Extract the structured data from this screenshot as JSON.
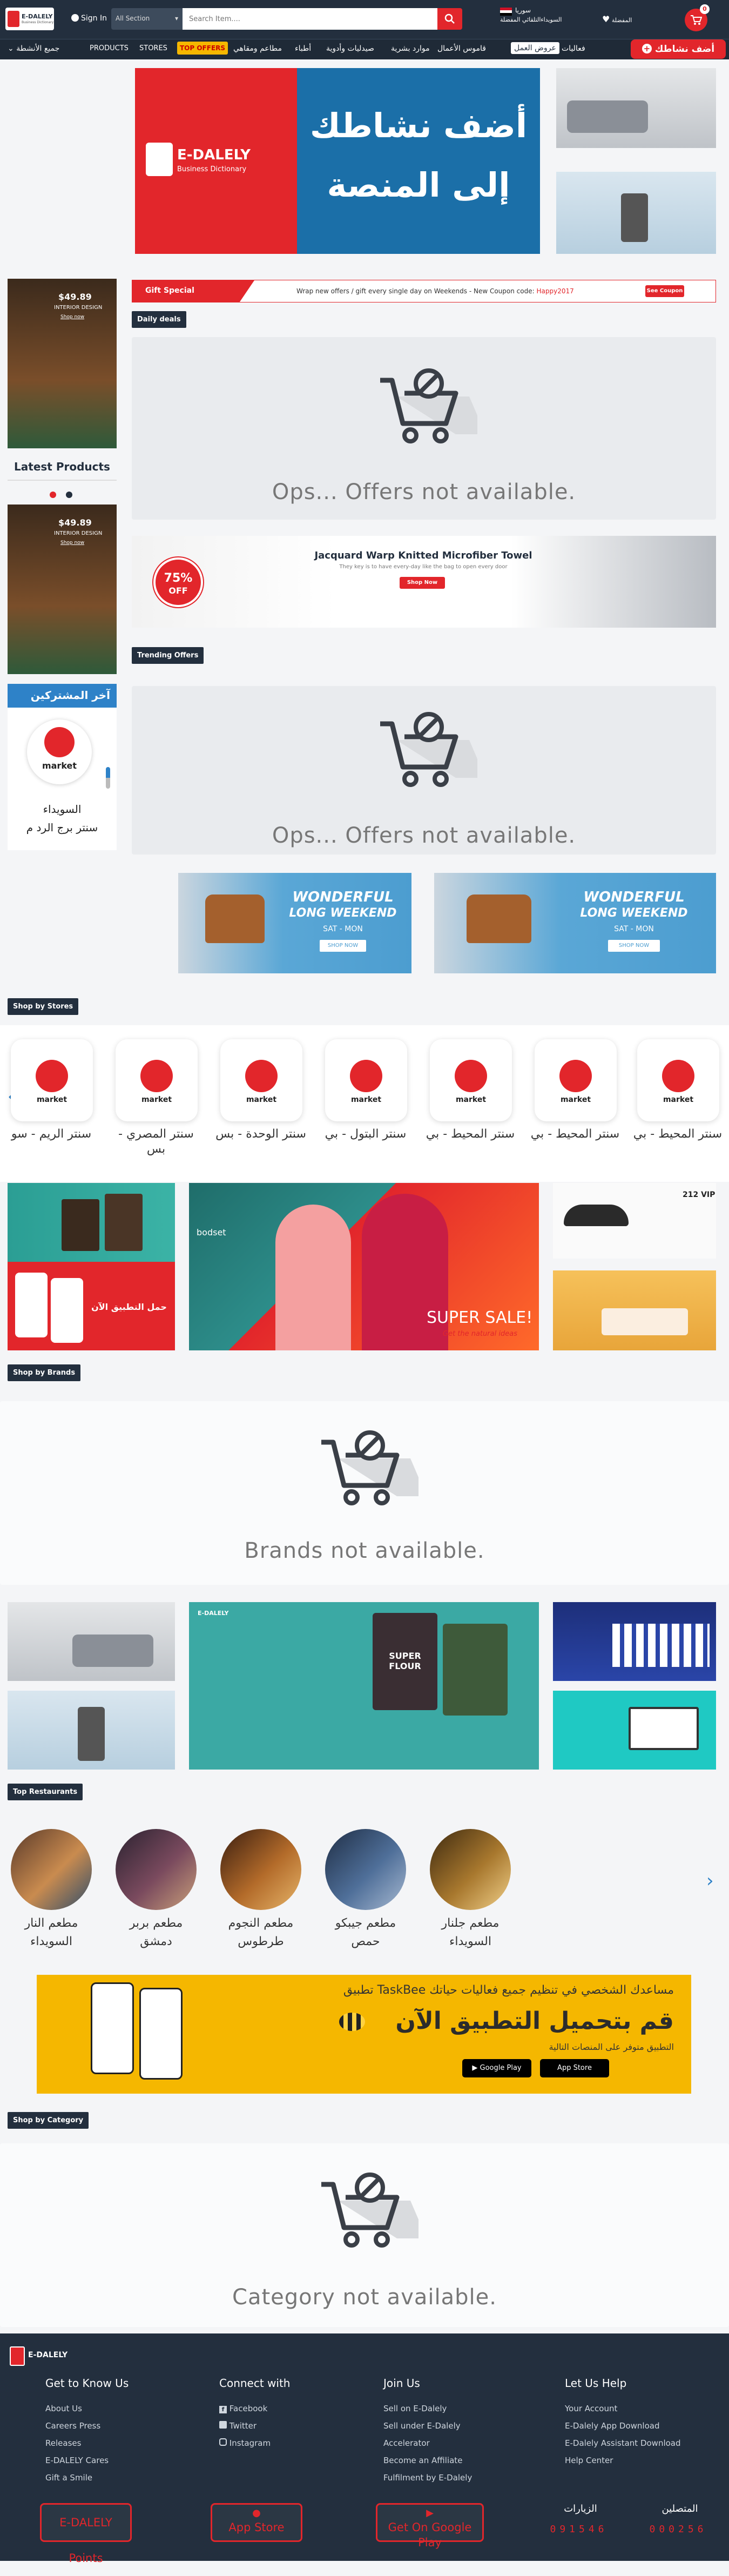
{
  "header": {
    "logo_text": "E-DALELY",
    "logo_sub": "Business Dictionary",
    "sign_in": "Sign In",
    "section_select": "All Section",
    "search_placeholder": "Search Item....",
    "country": "سوريا",
    "country_sub": "السويداءالتلقائي المفضلة",
    "favorites": "المفضلة",
    "cart_count": "0",
    "add_business": "أضف نشاطك"
  },
  "nav": {
    "all_activities": "جميع الأنشطة",
    "items": [
      "PRODUCTS",
      "STORES",
      "TOP OFFERS",
      "مطاعم ومقاهي",
      "أطباء",
      "صيدليات وأدوية",
      "موارد بشرية",
      "قاموس الأعمال",
      "عروض العمل",
      "فعاليات"
    ]
  },
  "hero": {
    "logo_text": "E-DALELY",
    "logo_sub": "Business Dictionary",
    "line1": "أضف نشاطك",
    "line2": "إلى المنصة"
  },
  "sidebar": {
    "promo_price": "$49.89",
    "promo_title": "INTERIOR DESIGN",
    "promo_link": "Shop now",
    "latest_products": "Latest Products",
    "latest_price": "$49.89",
    "latest_title": "INTERIOR DESIGN",
    "latest_link": "Shop now",
    "subscribers_title": "آخر المشتركين",
    "subscriber_logo": "market",
    "subscriber_city": "السويداء",
    "subscriber_name": "سنتر برج الرد م"
  },
  "gift": {
    "label": "Gift Special",
    "text": "Wrap new offers / gift every single day on Weekends - New Coupon code:",
    "code": "Happy2017",
    "button": "See Coupon"
  },
  "daily_deals": {
    "tag": "Daily deals",
    "empty": "Ops... Offers not available."
  },
  "towel_banner": {
    "badge_pct": "75%",
    "badge_off": "OFF",
    "title": "Jacquard Warp Knitted Microfiber Towel",
    "sub": "They key is to have every-day like the bag to open every door",
    "button": "Shop Now"
  },
  "trending": {
    "tag": "Trending Offers",
    "empty": "Ops... Offers not available."
  },
  "weekend_banners": [
    {
      "line1": "WONDERFUL",
      "line2": "LONG WEEKEND",
      "days": "SAT - MON",
      "button": "SHOP NOW"
    },
    {
      "line1": "WONDERFUL",
      "line2": "LONG WEEKEND",
      "days": "SAT - MON",
      "button": "SHOP NOW"
    }
  ],
  "stores": {
    "tag": "Shop by Stores",
    "logo": "market",
    "items": [
      "سنتر الريم - سو",
      "سنتر المصري - بس",
      "سنتر الوحدة - بس",
      "سنتر البتول - بي",
      "سنتر المحيط - بي",
      "سنتر المحيط - بي",
      "سنتر المحيط - بي"
    ]
  },
  "ads_row1": {
    "app_text": "حمل التطبيق الآن",
    "sale_brand": "bodset",
    "sale_text": "SUPER SALE!",
    "sale_sub": "Get the natural ideas",
    "beauty_brand": "212 VIP"
  },
  "brands": {
    "tag": "Shop by Brands",
    "empty": "Brands not available."
  },
  "ads_row2": {
    "flour_label": "SUPER FLOUR",
    "flour_logo": "E-DALELY"
  },
  "restaurants": {
    "tag": "Top Restaurants",
    "items": [
      {
        "name": "مطعم النار",
        "city": "السويداء"
      },
      {
        "name": "مطعم بربر",
        "city": "دمشق"
      },
      {
        "name": "مطعم النجوم",
        "city": "طرطوس"
      },
      {
        "name": "مطعم جيبكو",
        "city": "حمص"
      },
      {
        "name": "مطعم جلنار",
        "city": "السويداء"
      }
    ]
  },
  "taskbee": {
    "title": "تطبيق TaskBee مساعدك الشخصي في تنظيم جميع فعاليات حياتك",
    "headline": "قم بتحميل التطبيق الآن",
    "sub": "التطبيق متوفر على المنصات التالية",
    "google": "Google Play",
    "apple": "App Store"
  },
  "category": {
    "tag": "Shop by Category",
    "empty": "Category not available."
  },
  "footer": {
    "logo_text": "E-DALELY",
    "col1_title": "Get to Know Us",
    "col1": [
      "About Us",
      "Careers Press",
      "Releases",
      "E-DALELY Cares",
      "Gift a Smile"
    ],
    "col2_title": "Connect with",
    "col2": [
      "Facebook",
      "Twitter",
      "Instagram"
    ],
    "col3_title": "Join Us",
    "col3": [
      "Sell on E-Dalely",
      "Sell under E-Dalely",
      "Accelerator",
      "Become an Affiliate",
      "Fulfilment by E-Dalely"
    ],
    "col4_title": "Let Us Help",
    "col4": [
      "Your Account",
      "E-Dalely App Download",
      "E-Dalely Assistant Download",
      "Help Center"
    ],
    "btn_points": "E-DALELY Points",
    "btn_app": "App Store",
    "btn_google": "Get On Google Play",
    "visits_label": "الزيارات",
    "visits_value": "091546",
    "online_label": "المتصلين",
    "online_value": "000256"
  },
  "colors": {
    "dark": "#232f3e",
    "accent": "#e2262b",
    "yellow": "#f5b700"
  }
}
